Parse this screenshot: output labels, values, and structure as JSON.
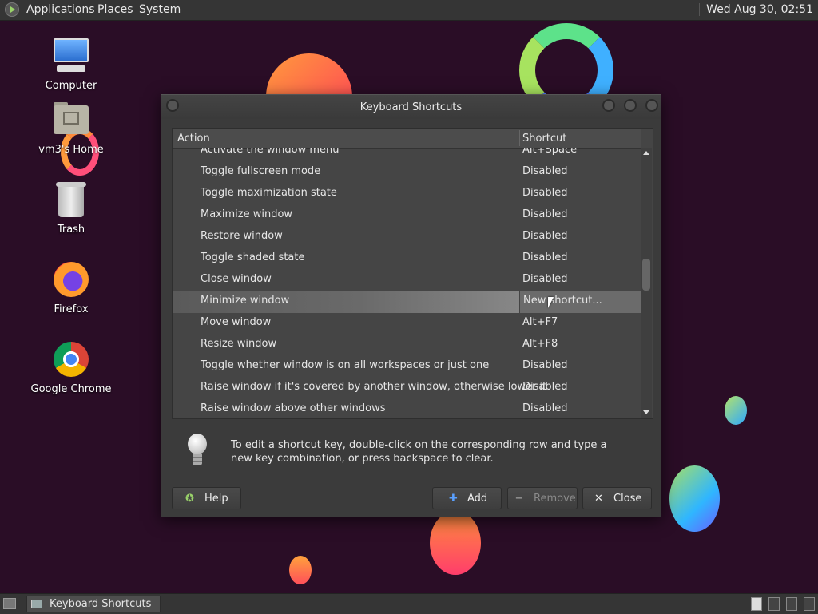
{
  "top_panel": {
    "menus": [
      "Applications",
      "Places",
      "System"
    ],
    "clock": "Wed Aug 30, 02:51"
  },
  "desktop": {
    "icons": [
      {
        "label": "Computer",
        "icon": "computer-icon"
      },
      {
        "label": "vm3's Home",
        "icon": "home-folder-icon"
      },
      {
        "label": "Trash",
        "icon": "trash-icon"
      },
      {
        "label": "Firefox",
        "icon": "firefox-icon"
      },
      {
        "label": "Google Chrome",
        "icon": "chrome-icon"
      }
    ]
  },
  "dialog": {
    "title": "Keyboard Shortcuts",
    "columns": {
      "action": "Action",
      "shortcut": "Shortcut"
    },
    "rows": [
      {
        "action": "Activate the window menu",
        "shortcut": "Alt+Space"
      },
      {
        "action": "Toggle fullscreen mode",
        "shortcut": "Disabled"
      },
      {
        "action": "Toggle maximization state",
        "shortcut": "Disabled"
      },
      {
        "action": "Maximize window",
        "shortcut": "Disabled"
      },
      {
        "action": "Restore window",
        "shortcut": "Disabled"
      },
      {
        "action": "Toggle shaded state",
        "shortcut": "Disabled"
      },
      {
        "action": "Close window",
        "shortcut": "Disabled"
      },
      {
        "action": "Minimize window",
        "shortcut": "New shortcut...",
        "selected": true
      },
      {
        "action": "Move window",
        "shortcut": "Alt+F7"
      },
      {
        "action": "Resize window",
        "shortcut": "Alt+F8"
      },
      {
        "action": "Toggle whether window is on all workspaces or just one",
        "shortcut": "Disabled"
      },
      {
        "action": "Raise window if it's covered by another window, otherwise lower it",
        "shortcut": "Disabled"
      },
      {
        "action": "Raise window above other windows",
        "shortcut": "Disabled"
      }
    ],
    "hint": "To edit a shortcut key, double-click on the corresponding row and type a new key combination, or press backspace to clear.",
    "buttons": {
      "help": "Help",
      "add": "Add",
      "remove": "Remove",
      "close": "Close"
    }
  },
  "taskbar": {
    "window_label": "Keyboard Shortcuts"
  }
}
